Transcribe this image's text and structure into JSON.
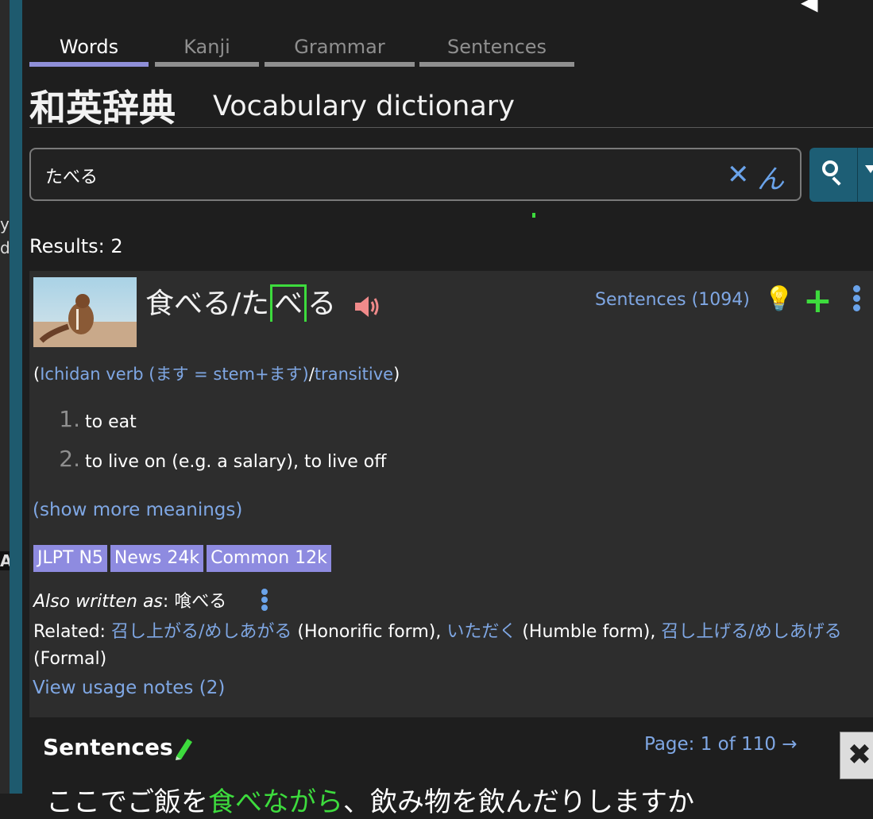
{
  "tabs": [
    {
      "label": "Words",
      "active": true
    },
    {
      "label": "Kanji",
      "active": false
    },
    {
      "label": "Grammar",
      "active": false
    },
    {
      "label": "Sentences",
      "active": false
    }
  ],
  "heading": {
    "japanese": "和英辞典",
    "english": "Vocabulary dictionary"
  },
  "search": {
    "value": "たべる",
    "clear_icon": "close-icon",
    "handwriting_icon": "handwriting-icon",
    "search_icon": "search-icon"
  },
  "results_label": "Results: 2",
  "entry": {
    "word_kanji": "食べる/た",
    "word_pitch": "べ",
    "word_tail": "る",
    "sentences_link": "Sentences (1094)",
    "pos_open": "(",
    "pos_verb": "Ichidan verb (ます = stem+ます)",
    "pos_sep": "/",
    "pos_trans": "transitive",
    "pos_close": ")",
    "meanings": [
      {
        "num": "1.",
        "text": "to eat"
      },
      {
        "num": "2.",
        "text": "to live on (e.g. a salary), to live off"
      }
    ],
    "show_more": "(show more meanings)",
    "badges": [
      "JLPT N5",
      "News 24k",
      "Common 12k"
    ],
    "also_written_label": "Also written as",
    "also_written_value": ": 喰べる",
    "related_label": "Related: ",
    "related": [
      {
        "word": "召し上がる/めしあがる",
        "note": " (Honorific form), "
      },
      {
        "word": "いただく",
        "note": " (Humble form), "
      },
      {
        "word": "召し上げる/めしあげる",
        "note": " (Formal)"
      }
    ],
    "usage_notes": "View usage notes (2)"
  },
  "sentences_section": {
    "title": "Sentences",
    "page_label": "Page: 1 of 110",
    "page_arrow": "→",
    "close_glyph": "✖",
    "partial_text_before": "ここでご飯を",
    "partial_text_green": "食べながら",
    "partial_text_after": "、飲み物を飲んだりしますか"
  },
  "left_strip_chars": [
    "y",
    "d",
    "A"
  ],
  "colors": {
    "accent": "#7fa7e4",
    "pitch_green": "#3ddb3d",
    "badge": "#8e8be0",
    "teal": "#1e5a6e"
  }
}
